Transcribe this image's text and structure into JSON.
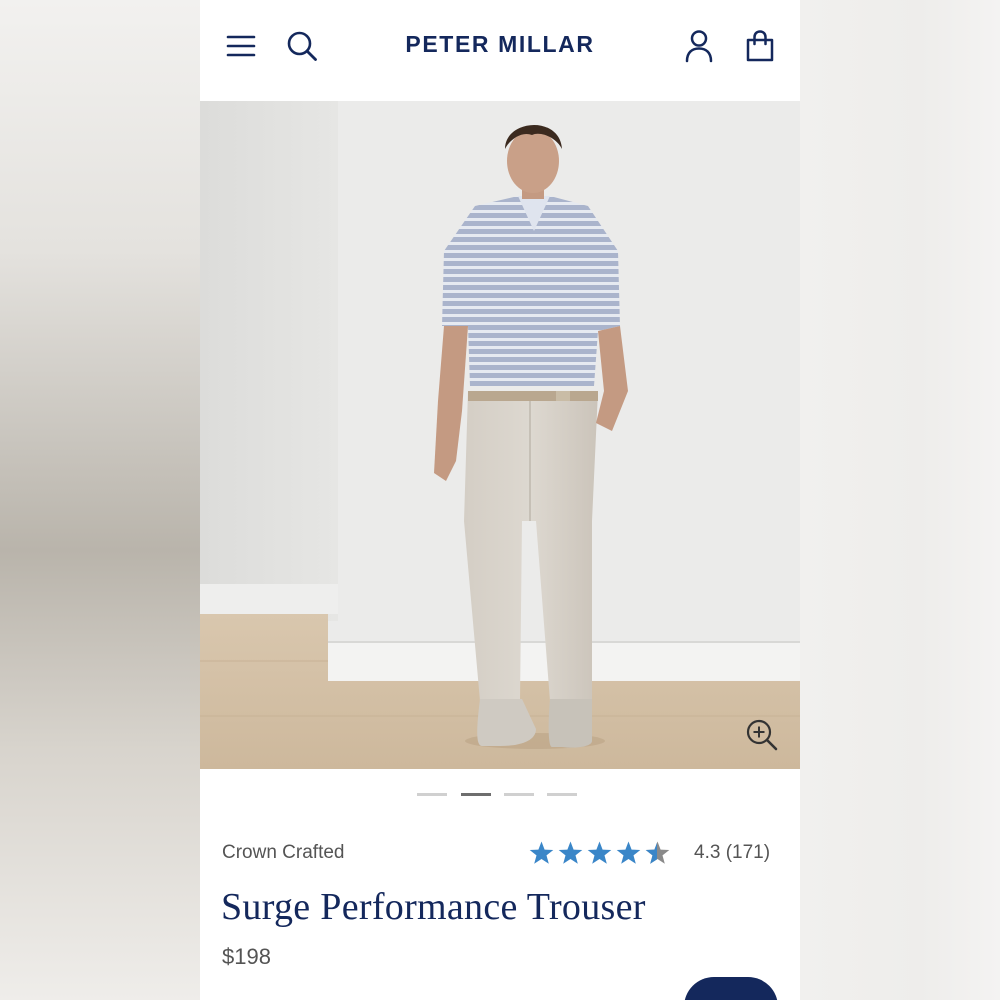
{
  "header": {
    "logo_text": "PETER MILLAR",
    "icons": [
      "menu-icon",
      "search-icon",
      "account-icon",
      "shopping-bag-icon"
    ]
  },
  "hero": {
    "zoom_icon": "zoom-in-icon",
    "carousel": {
      "total": 4,
      "active_index": 1
    }
  },
  "product": {
    "collection": "Crown Crafted",
    "rating_value": 4.3,
    "rating_text": "4.3 (171)",
    "title": "Surge Performance Trouser",
    "price": "$198"
  },
  "colors": {
    "brand_navy": "#14285c",
    "star_blue": "#3a86c8",
    "star_gray": "#8a8a8a",
    "text_gray": "#545454"
  }
}
